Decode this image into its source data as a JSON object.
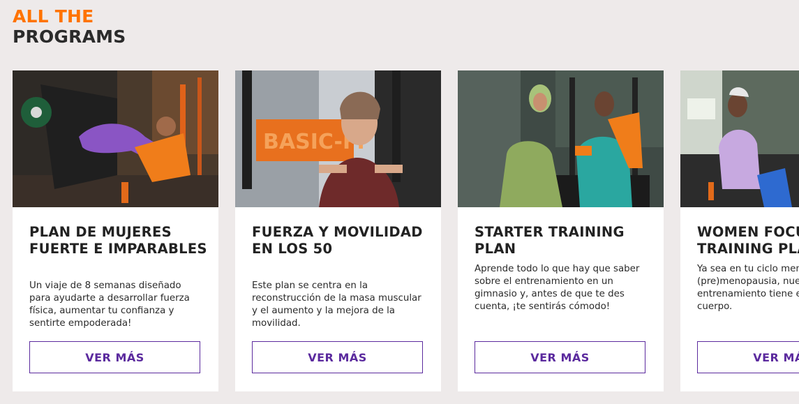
{
  "heading": {
    "line1": "ALL THE",
    "line2": "PROGRAMS"
  },
  "colors": {
    "accent_orange": "#ff7300",
    "button_purple": "#5b2a9e",
    "background": "#eeeaea"
  },
  "cards": [
    {
      "title": "PLAN DE MUJERES FUERTE E IMPARABLES",
      "description": "Un viaje de 8 semanas diseñado para ayudarte a desarrollar fuerza física, aumentar tu confianza y sentirte empoderada!",
      "button_label": "VER MÁS",
      "image": "woman-leg-press-photo"
    },
    {
      "title": "FUERZA Y MOVILIDAD EN LOS 50",
      "description": "Este plan se centra en la reconstrucción de la masa muscular y el aumento y la mejora de la movilidad.",
      "button_label": "VER MÁS",
      "image": "woman-chest-press-photo"
    },
    {
      "title": "STARTER TRAINING PLAN",
      "description": "Aprende todo lo que hay que saber sobre el entrenamiento en un gimnasio y, antes de que te des cuenta, ¡te sentirás cómodo!",
      "button_label": "VER MÁS",
      "image": "two-women-laughing-photo"
    },
    {
      "title": "WOMEN FOCUS TRAINING PLAN",
      "description": "Ya sea en tu ciclo menstrual o en la (pre)menopausia, nuestro plan de entrenamiento tiene en cuenta tu cuerpo.",
      "button_label": "VER MÁS",
      "image": "women-resting-gym-photo"
    }
  ]
}
